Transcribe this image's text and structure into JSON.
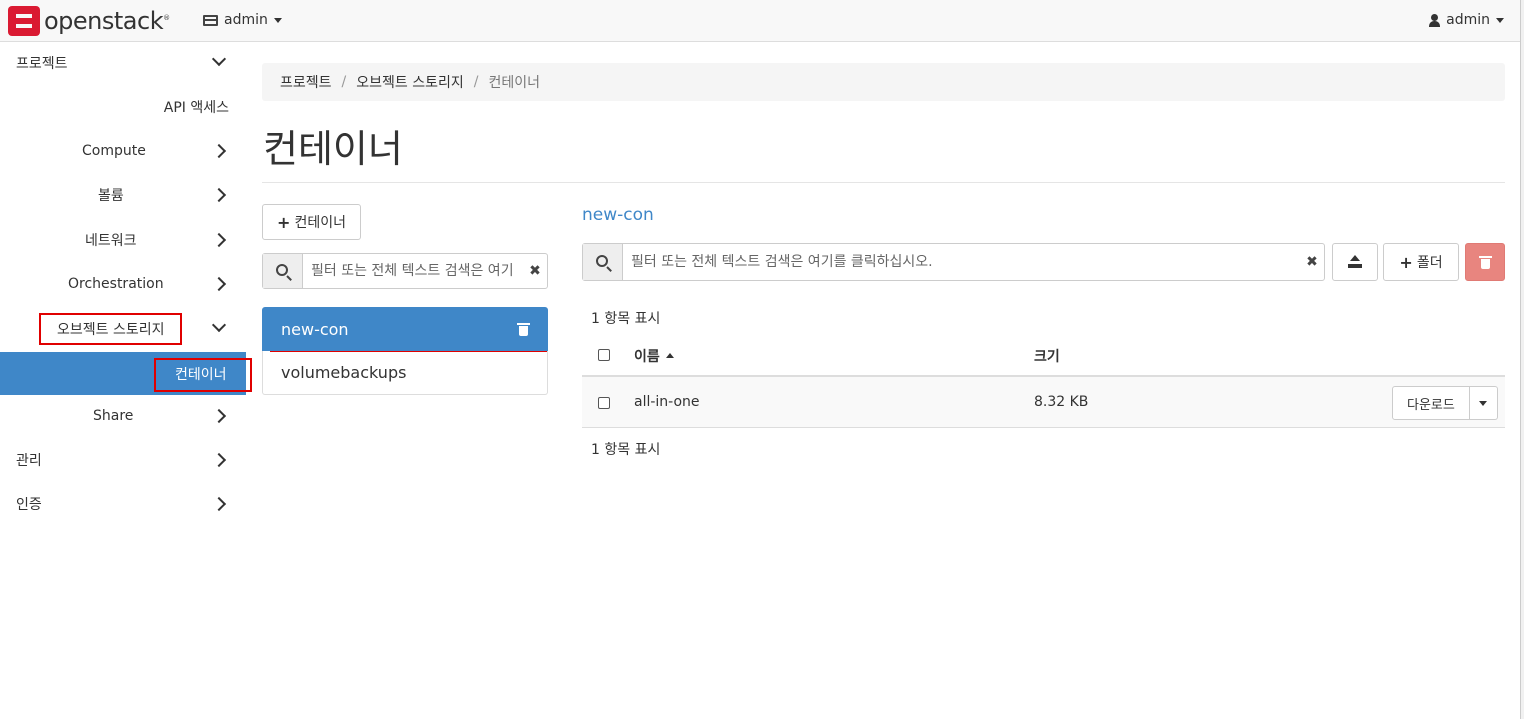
{
  "navbar": {
    "brand": "openstack",
    "brand_mark": "®",
    "project": "admin",
    "user": "admin"
  },
  "sidebar": {
    "items": [
      {
        "label": "프로젝트",
        "state": "expanded"
      },
      {
        "label": "API 액세스"
      },
      {
        "label": "Compute",
        "state": "collapsed"
      },
      {
        "label": "볼륨",
        "state": "collapsed"
      },
      {
        "label": "네트워크",
        "state": "collapsed"
      },
      {
        "label": "Orchestration",
        "state": "collapsed"
      },
      {
        "label": "오브젝트 스토리지",
        "state": "expanded"
      },
      {
        "label": "컨테이너",
        "state": "active"
      },
      {
        "label": "Share",
        "state": "collapsed"
      },
      {
        "label": "관리",
        "state": "collapsed"
      },
      {
        "label": "인증",
        "state": "collapsed"
      }
    ]
  },
  "breadcrumb": [
    "프로젝트",
    "오브젝트 스토리지",
    "컨테이너"
  ],
  "page_title": "컨테이너",
  "containers": {
    "add_button": "컨테이너",
    "filter_placeholder": "필터 또는 전체 텍스트 검색은 여기",
    "items": [
      {
        "name": "new-con",
        "active": true
      },
      {
        "name": "volumebackups",
        "active": false
      }
    ]
  },
  "objects": {
    "container_name": "new-con",
    "filter_placeholder": "필터 또는 전체 텍스트 검색은 여기를 클릭하십시오.",
    "folder_button": "폴더",
    "count_top": "1 항목 표시",
    "count_bottom": "1 항목 표시",
    "columns": {
      "name": "이름",
      "size": "크기"
    },
    "rows": [
      {
        "name": "all-in-one",
        "size": "8.32 KB",
        "action": "다운로드"
      }
    ]
  },
  "colors": {
    "accent": "#3f87c8",
    "brand": "#da1a32",
    "danger": "#e8857f",
    "highlight": "#e00000"
  }
}
